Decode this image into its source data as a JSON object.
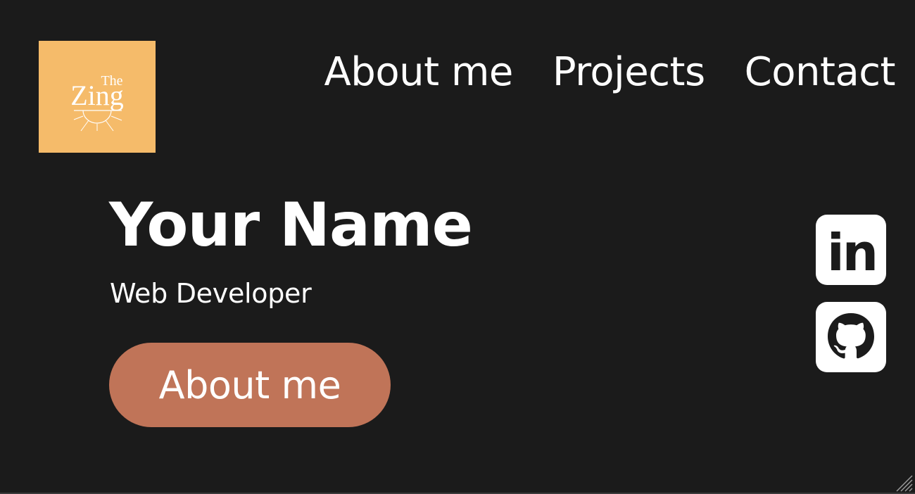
{
  "logo": {
    "line1": "The",
    "line2": "Zing",
    "background": "#f5bb6a"
  },
  "nav": {
    "items": [
      {
        "label": "About me"
      },
      {
        "label": "Projects"
      },
      {
        "label": "Contact"
      }
    ]
  },
  "hero": {
    "name": "Your Name",
    "subtitle": "Web Developer",
    "button_label": "About me",
    "button_color": "#c07458"
  },
  "social": {
    "items": [
      {
        "icon": "linkedin-icon",
        "glyph": "in"
      },
      {
        "icon": "github-icon"
      }
    ]
  },
  "theme": {
    "background": "#1b1b1b",
    "text": "#ffffff"
  }
}
